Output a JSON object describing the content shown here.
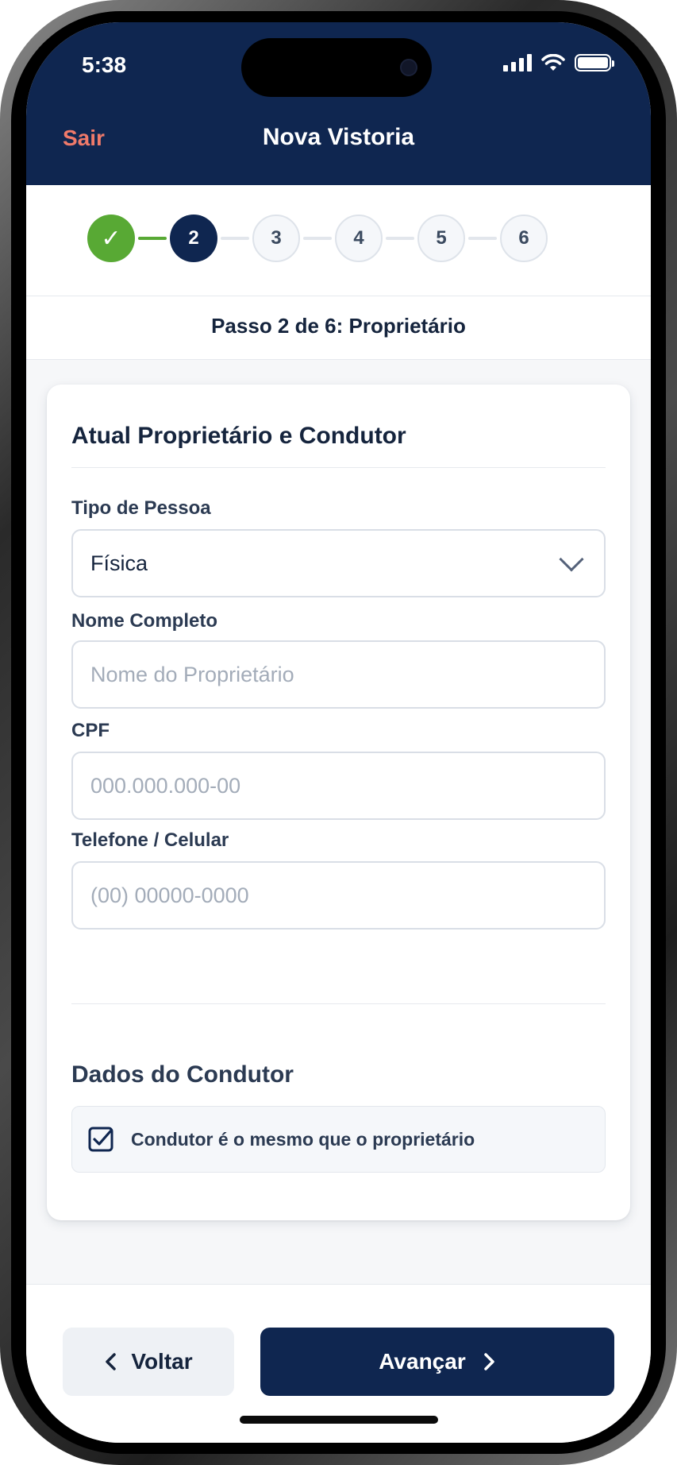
{
  "status_bar": {
    "time": "5:38"
  },
  "header": {
    "exit_label": "Sair",
    "title": "Nova Vistoria"
  },
  "stepper": {
    "steps": [
      {
        "label": "✓",
        "state": "done"
      },
      {
        "label": "2",
        "state": "active"
      },
      {
        "label": "3",
        "state": "todo"
      },
      {
        "label": "4",
        "state": "todo"
      },
      {
        "label": "5",
        "state": "todo"
      },
      {
        "label": "6",
        "state": "todo"
      }
    ],
    "caption": "Passo 2 de 6: Proprietário"
  },
  "form": {
    "title": "Atual Proprietário e Condutor",
    "person_type": {
      "label": "Tipo de Pessoa",
      "value": "Física"
    },
    "full_name": {
      "label": "Nome Completo",
      "placeholder": "Nome do Proprietário"
    },
    "cpf": {
      "label": "CPF",
      "placeholder": "000.000.000-00"
    },
    "phone": {
      "label": "Telefone / Celular",
      "placeholder": "(00) 00000-0000"
    },
    "driver_section": {
      "title": "Dados do Condutor",
      "same_as_owner_label": "Condutor é o mesmo que o proprietário",
      "same_as_owner_checked": true
    }
  },
  "footer": {
    "back_label": "Voltar",
    "next_label": "Avançar"
  },
  "colors": {
    "primary": "#0f2650",
    "success": "#58a934",
    "danger_text": "#f07a6a"
  }
}
